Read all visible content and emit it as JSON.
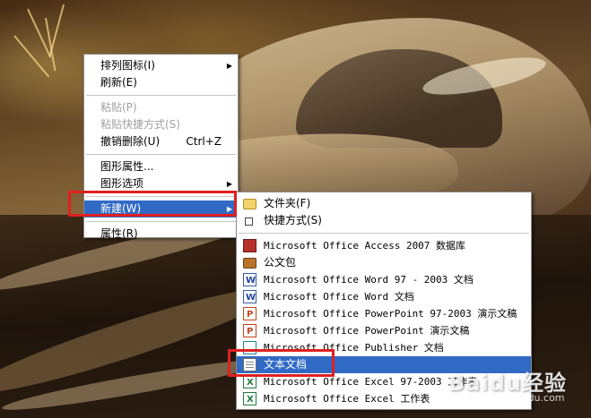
{
  "main_menu": {
    "items": [
      {
        "label": "排列图标(I)",
        "submenu": true
      },
      {
        "label": "刷新(E)"
      },
      {
        "label": "粘贴(P)",
        "disabled": true
      },
      {
        "label": "粘贴快捷方式(S)",
        "disabled": true
      },
      {
        "label": "撤销删除(U)",
        "shortcut": "Ctrl+Z"
      },
      {
        "label": "图形属性..."
      },
      {
        "label": "图形选项",
        "submenu": true
      },
      {
        "label": "新建(W)",
        "submenu": true,
        "selected": true
      },
      {
        "label": "属性(R)"
      }
    ]
  },
  "new_submenu": {
    "items": [
      {
        "label": "文件夹(F)",
        "icon": "folder-icon"
      },
      {
        "label": "快捷方式(S)",
        "icon": "shortcut-icon"
      },
      {
        "label": "Microsoft Office Access 2007 数据库",
        "icon": "access-icon"
      },
      {
        "label": "公文包",
        "icon": "briefcase-icon"
      },
      {
        "label": "Microsoft Office Word 97 - 2003 文档",
        "icon": "word-icon"
      },
      {
        "label": "Microsoft Office Word 文档",
        "icon": "word-icon"
      },
      {
        "label": "Microsoft Office PowerPoint 97-2003 演示文稿",
        "icon": "powerpoint-icon"
      },
      {
        "label": "Microsoft Office PowerPoint 演示文稿",
        "icon": "powerpoint-icon"
      },
      {
        "label": "Microsoft Office Publisher 文档",
        "icon": "publisher-icon"
      },
      {
        "label": "文本文档",
        "icon": "text-document-icon",
        "selected": true
      },
      {
        "label": "Microsoft Office Excel 97-2003 工作表",
        "icon": "excel-icon"
      },
      {
        "label": "Microsoft Office Excel 工作表",
        "icon": "excel-icon"
      }
    ]
  },
  "watermark": {
    "brand": "Baidu经验",
    "url": "jingyan.baidu.com"
  },
  "colors": {
    "selection": "#316ac5",
    "annotation": "#e02020"
  }
}
